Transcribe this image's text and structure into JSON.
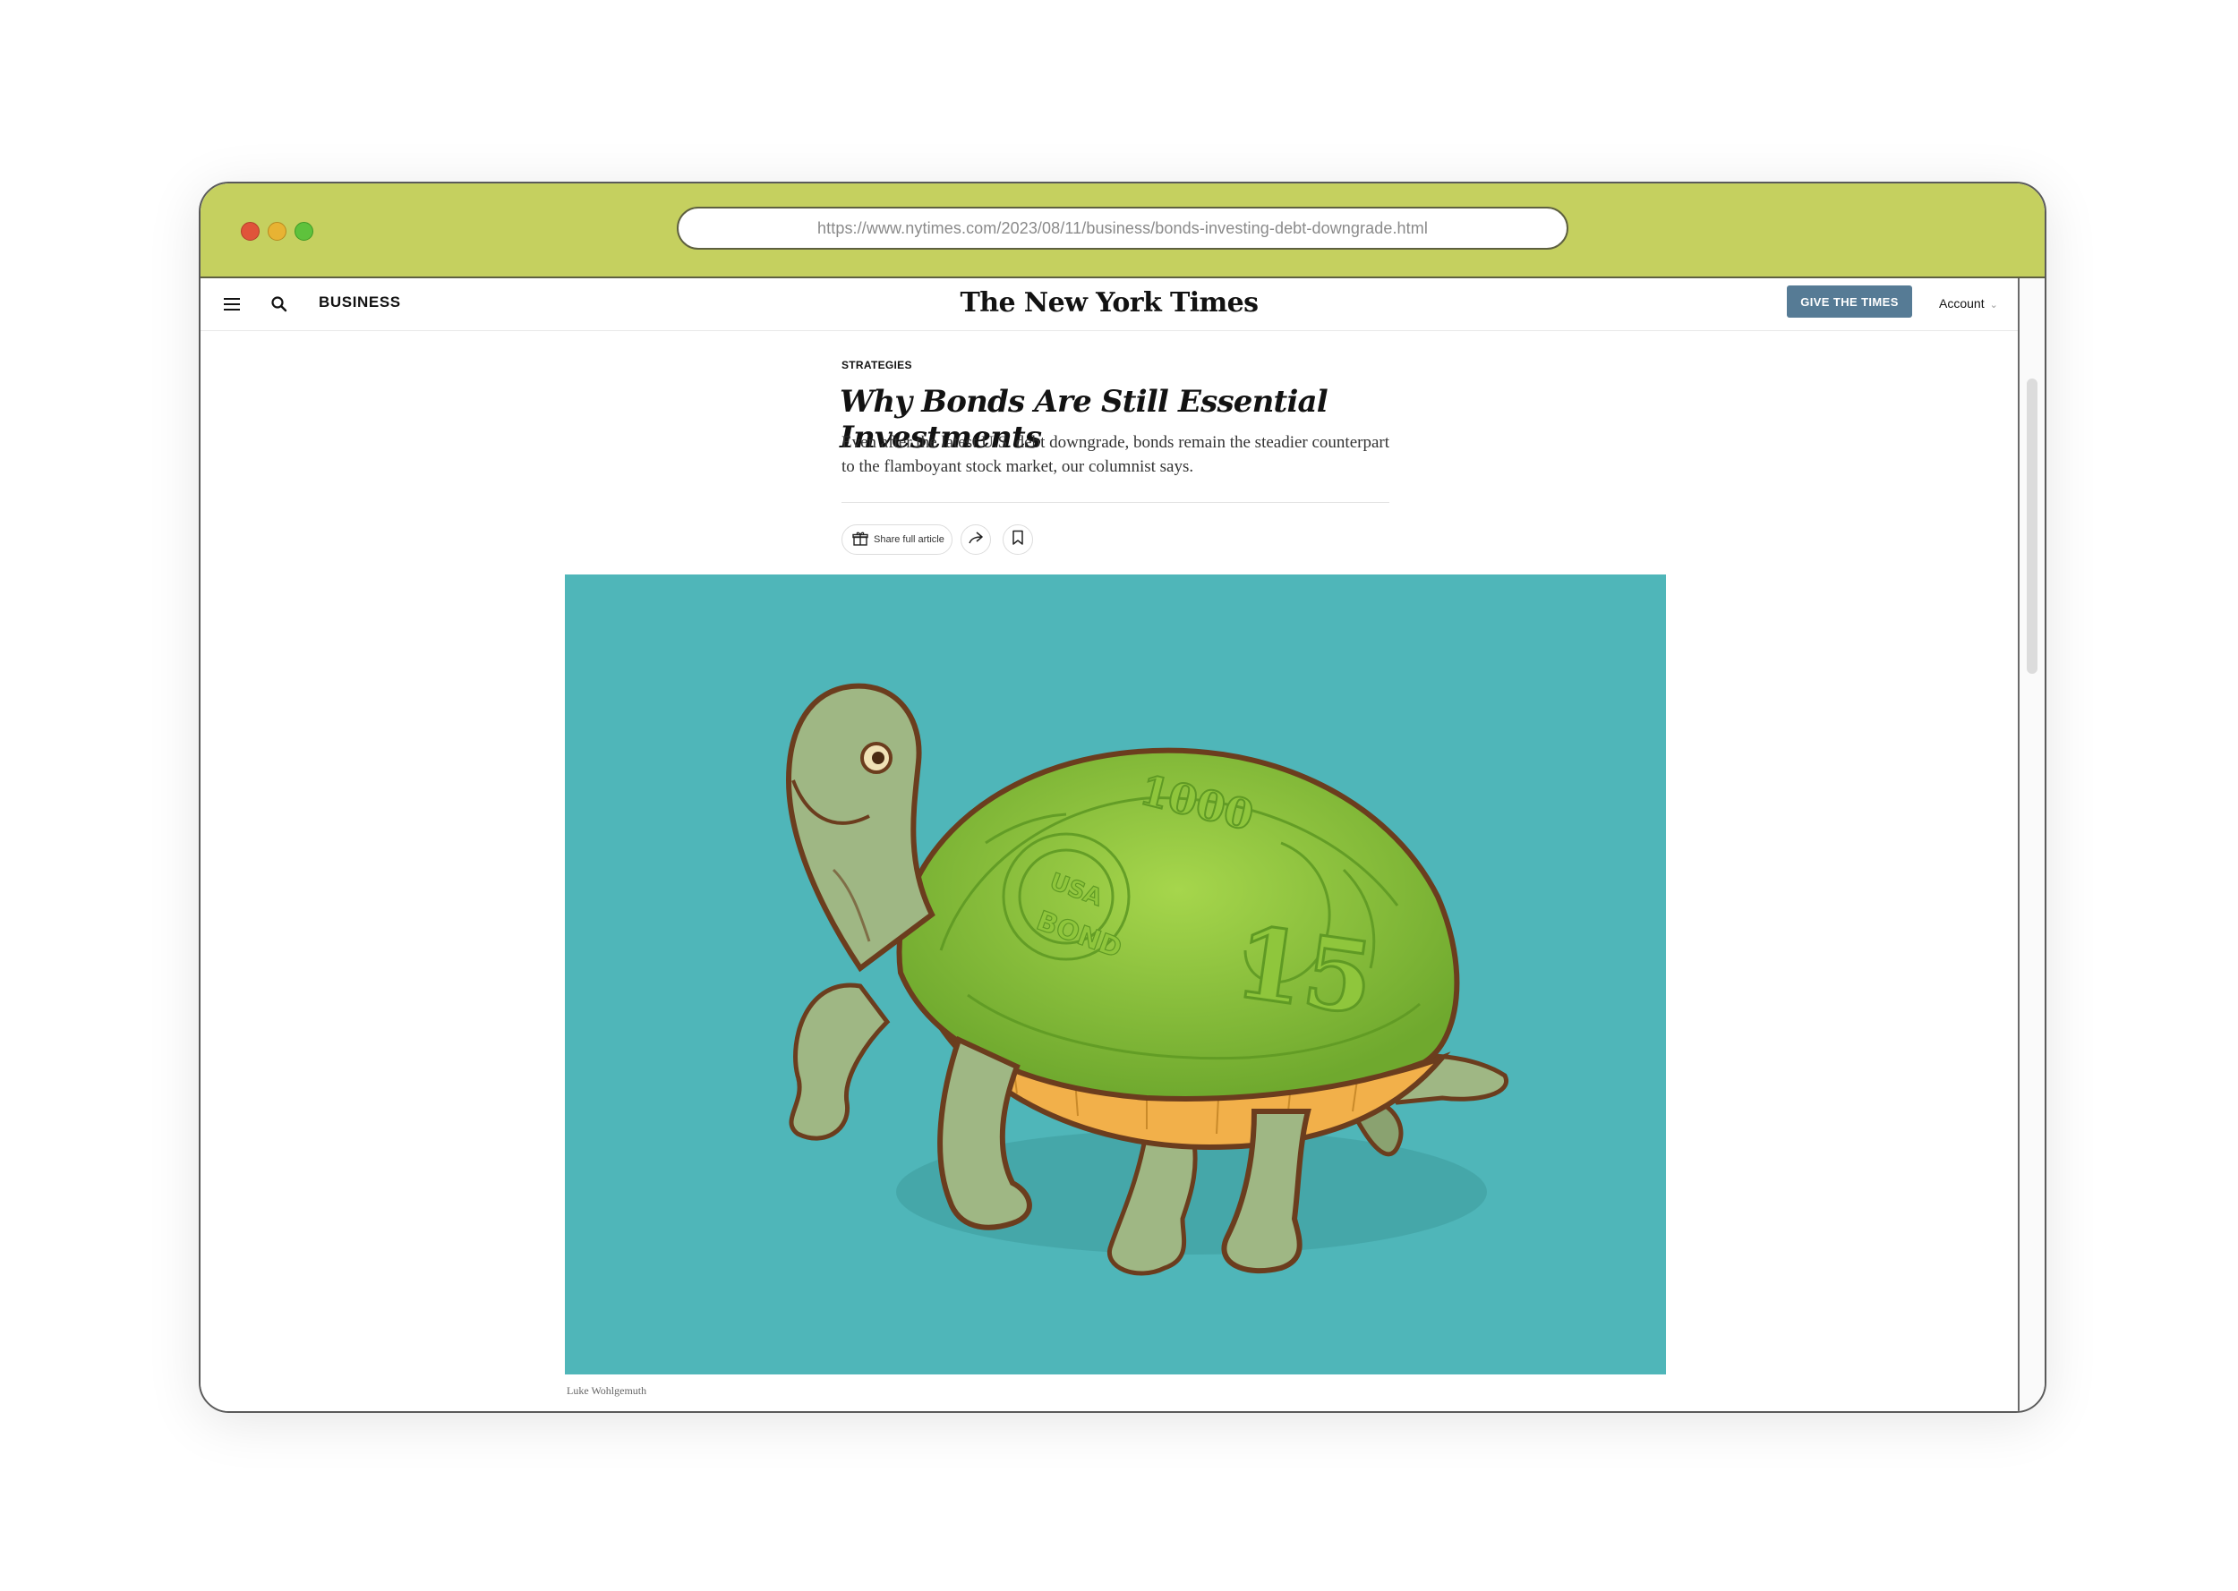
{
  "browser": {
    "url": "https://www.nytimes.com/2023/08/11/business/bonds-investing-debt-downgrade.html",
    "controls": {
      "close": "close-dot",
      "minimize": "minimize-dot",
      "maximize": "maximize-dot"
    }
  },
  "header": {
    "menu_icon": "hamburger-menu-icon",
    "search_icon": "search-icon",
    "section": "BUSINESS",
    "logo": "The New York Times",
    "give_button": "GIVE THE TIMES",
    "account_label": "Account",
    "account_chevron": "⌄"
  },
  "article": {
    "kicker": "STRATEGIES",
    "headline": "Why Bonds Are Still Essential Investments",
    "summary": "Even after the latest U.S. debt downgrade, bonds remain the steadier counterpart to the flamboyant stock market, our columnist says.",
    "share_full_label": "Share full article",
    "share_icon": "share-arrow-icon",
    "bookmark_icon": "bookmark-icon",
    "gift_icon": "gift-icon",
    "image_credit": "Luke Wohlgemuth",
    "image_shell_text": {
      "denomination": "1000",
      "bond_top": "USA",
      "bond_bottom": "BOND",
      "number": "15"
    }
  },
  "colors": {
    "titlebar": "#c5d05f",
    "image_background": "#4fb6b9",
    "give_button": "#567b95"
  }
}
